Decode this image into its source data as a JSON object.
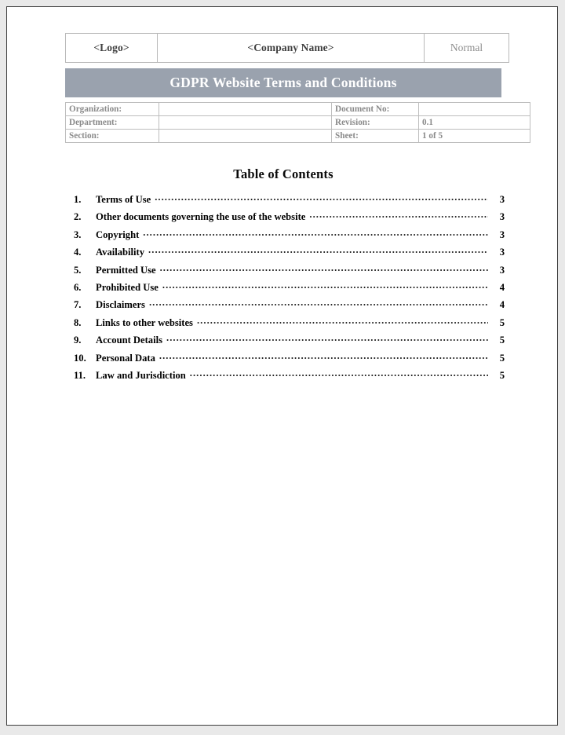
{
  "document": {
    "header": {
      "logo_placeholder": "<Logo>",
      "company_placeholder": "<Company Name>",
      "classification": "Normal"
    },
    "title": "GDPR Website Terms and Conditions",
    "meta": {
      "rows": [
        {
          "label_left": "Organization:",
          "value_left": "",
          "label_right": "Document No:",
          "value_right": ""
        },
        {
          "label_left": "Department:",
          "value_left": "",
          "label_right": "Revision:",
          "value_right": "0.1"
        },
        {
          "label_left": "Section:",
          "value_left": "",
          "label_right": "Sheet:",
          "value_right": "1 of 5"
        }
      ]
    },
    "toc": {
      "heading": "Table of Contents",
      "entries": [
        {
          "number": "1.",
          "label": "Terms of Use",
          "page": "3"
        },
        {
          "number": "2.",
          "label": "Other documents governing the use of the website",
          "page": "3"
        },
        {
          "number": "3.",
          "label": "Copyright",
          "page": "3"
        },
        {
          "number": "4.",
          "label": "Availability",
          "page": "3"
        },
        {
          "number": "5.",
          "label": "Permitted Use",
          "page": "3"
        },
        {
          "number": "6.",
          "label": "Prohibited Use",
          "page": "4"
        },
        {
          "number": "7.",
          "label": "Disclaimers",
          "page": "4"
        },
        {
          "number": "8.",
          "label": "Links to other websites",
          "page": "5"
        },
        {
          "number": "9.",
          "label": "Account Details",
          "page": "5"
        },
        {
          "number": "10.",
          "label": "Personal Data",
          "page": "5"
        },
        {
          "number": "11.",
          "label": "Law and Jurisdiction",
          "page": "5"
        }
      ]
    },
    "colors": {
      "title_band": "#9aa2ae",
      "title_text": "#ffffff",
      "meta_text": "#8a8a8a",
      "page_border": "#3c3c3c"
    }
  }
}
